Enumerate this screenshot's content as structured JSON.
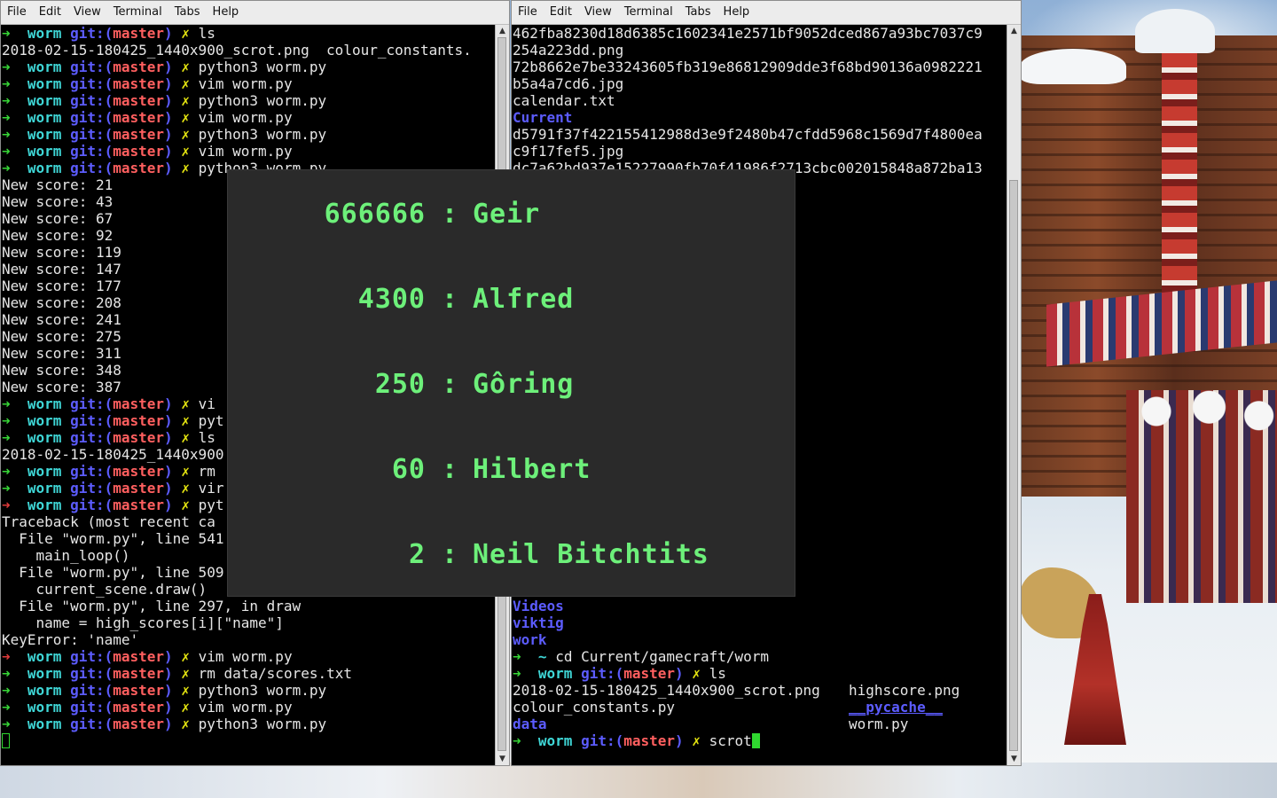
{
  "colors": {
    "terminal_bg": "#000000",
    "prompt_arrow": "#37d737",
    "prompt_dir": "#3fd7d7",
    "git_label": "#5c5cff",
    "git_branch": "#ff5f5f",
    "dirty_mark": "#e5e510",
    "game_bg": "#2a2a2a",
    "score_text": "#6df07a"
  },
  "menu": {
    "file": "File",
    "edit": "Edit",
    "view": "View",
    "terminal": "Terminal",
    "tabs": "Tabs",
    "help": "Help"
  },
  "prompt": {
    "arrow": "➜",
    "dir": "worm",
    "git": "git:(",
    "branch": "master",
    "close": ")",
    "mark": "✗",
    "home": "~"
  },
  "left_terminal": {
    "line1_cmd": "ls",
    "line2": "2018-02-15-180425_1440x900_scrot.png  colour_constants.",
    "cmd_python": "python3 worm.py",
    "cmd_vim": "vim worm.py",
    "cmd_python_partial": "python3 worm.py",
    "scores": [
      "New score: 21",
      "New score: 43",
      "New score: 67",
      "New score: 92",
      "New score: 119",
      "New score: 147",
      "New score: 177",
      "New score: 208",
      "New score: 241",
      "New score: 275",
      "New score: 311",
      "New score: 348",
      "New score: 387"
    ],
    "cmd_vi_trunc": "vi",
    "cmd_pyt_trunc": "pyt",
    "cmd_ls": "ls",
    "ls_trunc": "2018-02-15-180425_1440x900",
    "cmd_rm_trunc": "rm",
    "cmd_vir_trunc": "vir",
    "traceback": "Traceback (most recent ca",
    "tb_file1": "  File \"worm.py\", line 541",
    "tb_code1": "    main_loop()",
    "tb_file2": "  File \"worm.py\", line 509",
    "tb_code2": "    current_scene.draw()",
    "tb_file3": "  File \"worm.py\", line 297, in draw",
    "tb_code3": "    name = high_scores[i][\"name\"]",
    "key_error": "KeyError: 'name'",
    "cmd_rm_scores": "rm data/scores.txt"
  },
  "right_terminal": {
    "hash1a": "462fba8230d18d6385c1602341e2571bf9052dced867a93bc7037c9",
    "hash1b": "254a223dd.png",
    "hash2a": "72b8662e7be33243605fb319e86812909dde3f68bd90136a0982221",
    "hash2b": "b5a4a7cd6.jpg",
    "calendar": "calendar.txt",
    "current_dir": "Current",
    "hash3a": "d5791f37f422155412988d3e9f2480b47cfdd5968c1569d7f4800ea",
    "hash3b": "c9f17fef5.jpg",
    "hash4a": "dc7a62bd937e15227990fb70f41986f2713cbc002015848a872ba13",
    "dir_videos": "Videos",
    "dir_viktig": "viktig",
    "dir_work": "work",
    "cmd_cd": "cd Current/gamecraft/worm",
    "cmd_ls": "ls",
    "ls_scrot": "2018-02-15-180425_1440x900_scrot.png",
    "ls_highscore": "highscore.png",
    "ls_colour": "colour_constants.py",
    "ls_pycache": "__pycache__",
    "ls_data": "data",
    "ls_worm": "worm.py",
    "cmd_scrot": "scrot"
  },
  "high_scores": [
    {
      "score": "666666",
      "sep": ":",
      "name": "Geir"
    },
    {
      "score": "4300",
      "sep": ":",
      "name": "Alfred"
    },
    {
      "score": "250",
      "sep": ":",
      "name": "Gôring"
    },
    {
      "score": "60",
      "sep": ":",
      "name": "Hilbert"
    },
    {
      "score": "2",
      "sep": ":",
      "name": "Neil Bitchtits"
    }
  ],
  "scrollbar": {
    "up_icon": "▲",
    "down_icon": "▼"
  }
}
